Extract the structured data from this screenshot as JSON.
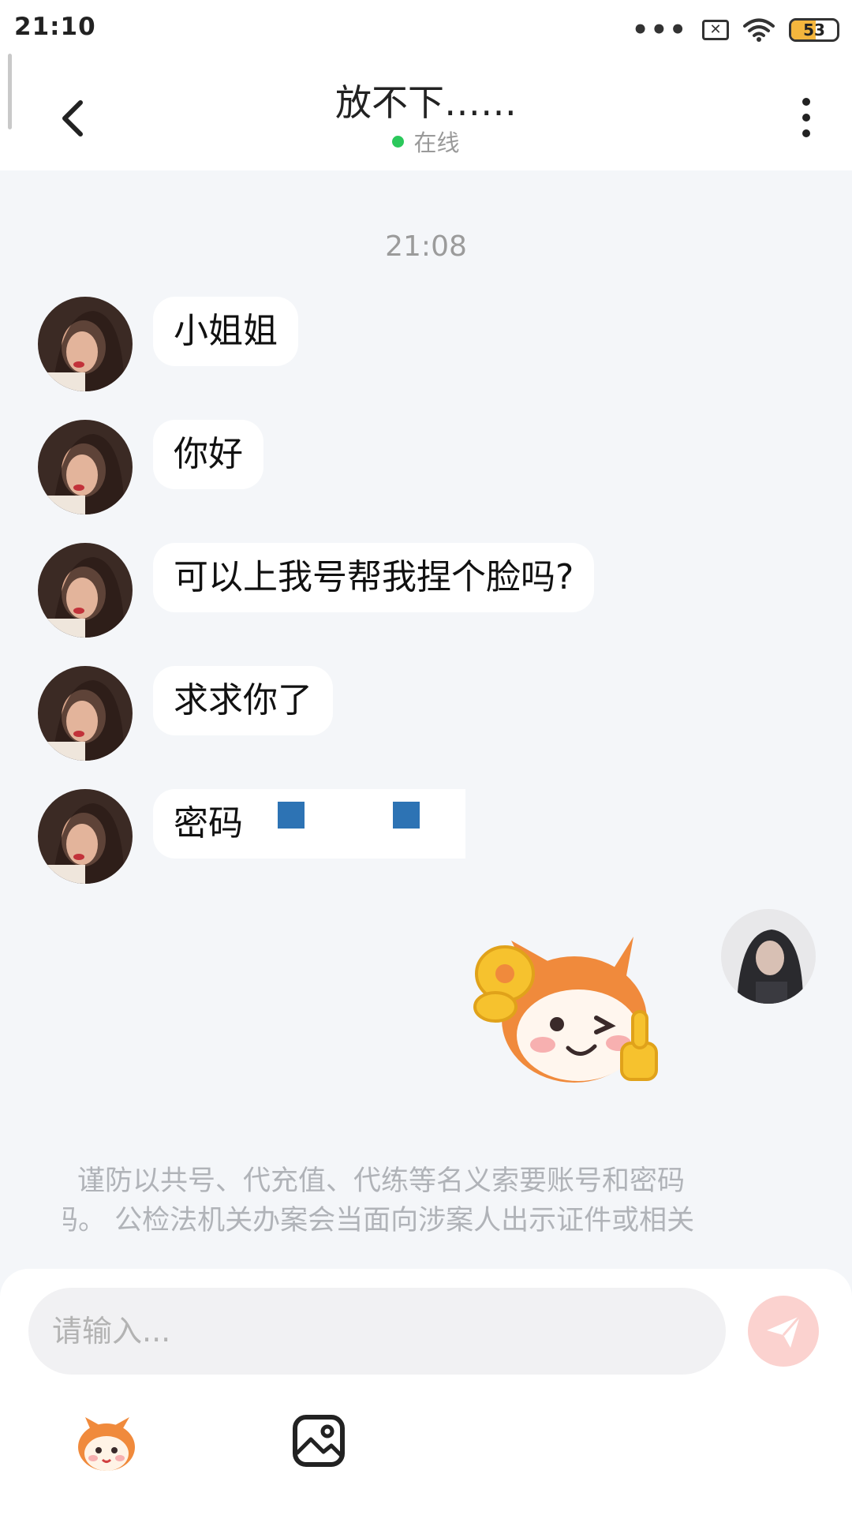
{
  "status_bar": {
    "time": "21:10",
    "more_icon": "more-dots-icon",
    "sim_icon": "sim-x-icon",
    "wifi_icon": "wifi-icon",
    "battery_level": 53,
    "battery_text": "53",
    "battery_color": "#f4b63d"
  },
  "header": {
    "title": "放不下……",
    "status_text": "在线",
    "status_color": "#2bc85b",
    "back_icon": "chevron-left-icon",
    "menu_icon": "more-vertical-icon"
  },
  "chat": {
    "timestamp": "21:08",
    "received": [
      {
        "text": "小姐姐"
      },
      {
        "text": "你好"
      },
      {
        "text": "可以上我号帮我捏个脸吗?"
      },
      {
        "text": "求求你了"
      },
      {
        "text": "密码"
      }
    ],
    "sent_sticker": "thumbs-up-wink-sticker"
  },
  "notice": {
    "line1": "谨防以共号、代充值、代练等名义索要账号和密码",
    "line2": "码。 公检法机关办案会当面向涉案人出示证件或相关"
  },
  "composer": {
    "placeholder": "请输入...",
    "send_icon": "send-plane-icon",
    "send_color": "#fbd2cf",
    "emoji_icon": "mascot-emoji-icon",
    "image_icon": "image-icon"
  }
}
